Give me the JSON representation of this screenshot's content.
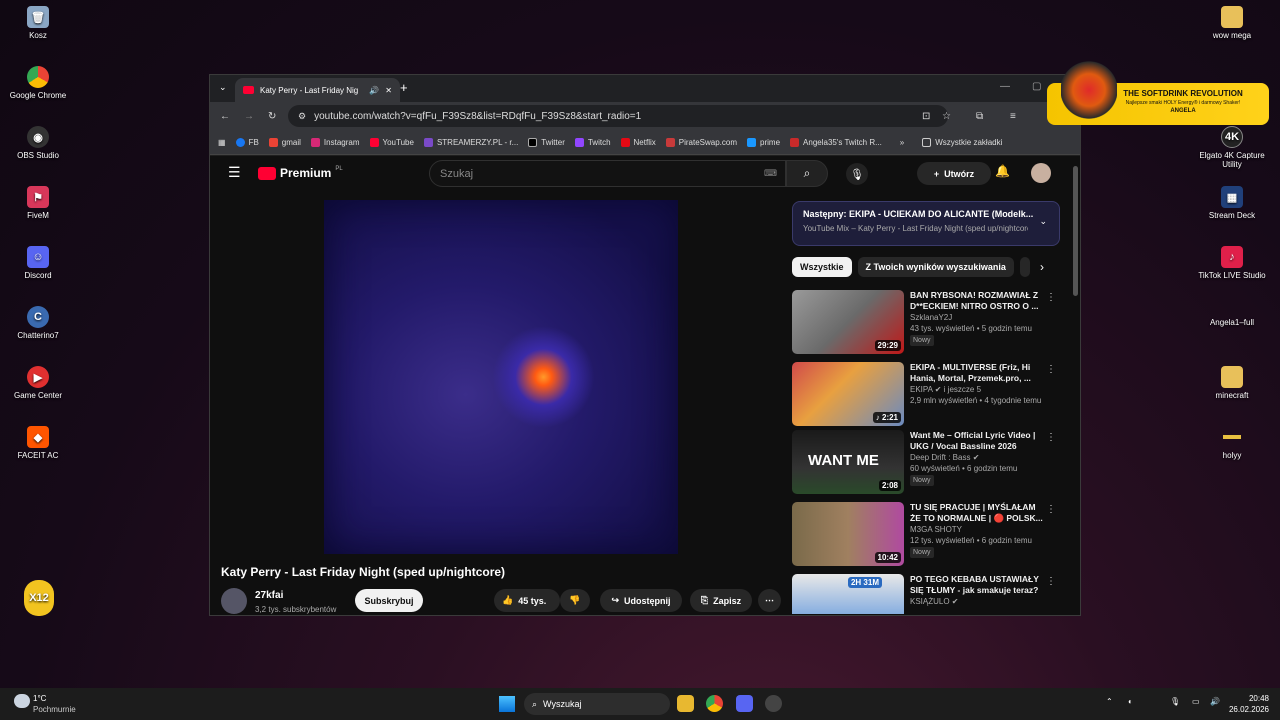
{
  "desktop": {
    "left": [
      "Kosz",
      "Google Chrome",
      "OBS Studio",
      "FiveM",
      "Discord",
      "Chatterino7",
      "Game Center",
      "FACEIT AC"
    ],
    "right": [
      "wow mega",
      "",
      "Elgato 4K Capture Utility",
      "Stream Deck",
      "TikTok LIVE Studio",
      "Angela1–full",
      "minecraft",
      "holyy"
    ]
  },
  "tab": {
    "title": "Katy Perry - Last Friday Nig"
  },
  "address": "youtube.com/watch?v=qfFu_F39Sz8&list=RDqfFu_F39Sz8&start_radio=1",
  "bookmarks": [
    "FB",
    "gmail",
    "Instagram",
    "YouTube",
    "STREAMERZY.PL - r...",
    "Twitter",
    "Twitch",
    "Netflix",
    "PirateSwap.com",
    "prime",
    "Angela35's Twitch R..."
  ],
  "all_bookmarks": "Wszystkie zakładki",
  "yt": {
    "logo": "Premium",
    "region": "PL",
    "search_placeholder": "Szukaj",
    "create": "Utwórz"
  },
  "video": {
    "title": "Katy Perry - Last Friday Night (sped up/nightcore)",
    "channel": "27kfai",
    "subs": "3,2 tys. subskrybentów",
    "subscribe": "Subskrybuj",
    "likes": "45 tys.",
    "share": "Udostępnij",
    "save": "Zapisz"
  },
  "next": {
    "label": "Następny:",
    "title": "EKIPA - UCIEKAM DO ALICANTE (Modelk...",
    "sub": "YouTube Mix – Katy Perry - Last Friday Night (sped up/nightcore)"
  },
  "chips": [
    "Wszystkie",
    "Z Twoich wyników wyszukiwania"
  ],
  "recs": [
    {
      "t1": "BAN RYBSONA! ROZMAWIAŁ Z",
      "t2": "D**ECKIEM! NITRO OSTRO O ...",
      "ch": "SzklanaY2J",
      "meta": "43 tys. wyświetleń • 5 godzin temu",
      "badge": "Nowy",
      "dur": "29:29",
      "c1": "#9a9a9a",
      "c2": "#c01818"
    },
    {
      "t1": "EKIPA - MULTIVERSE (Friz, Hi",
      "t2": "Hania, Mortal, Przemek.pro, ...",
      "ch": "EKIPA ✔ i jeszcze 5",
      "meta": "2,9 mln wyświetleń • 4 tygodnie temu",
      "badge": "",
      "dur": "♪ 2:21",
      "c1": "#d04a4a",
      "c2": "#6a8ac0"
    },
    {
      "t1": "Want Me – Official Lyric Video |",
      "t2": "UKG / Vocal Bassline 2026",
      "ch": "Deep Drift : Bass ✔",
      "meta": "60 wyświetleń • 6 godzin temu",
      "badge": "Nowy",
      "dur": "2:08",
      "c1": "#1a1a1a",
      "c2": "#2a4a2a"
    },
    {
      "t1": "TU SIĘ PRACUJE | MYŚLAŁAM",
      "t2": "ŻE TO NORMALNE | 🔴 POLSK...",
      "ch": "M3GA SHOTY",
      "meta": "12 tys. wyświetleń • 6 godzin temu",
      "badge": "Nowy",
      "dur": "10:42",
      "c1": "#7a6a4a",
      "c2": "#b04aa0"
    },
    {
      "t1": "PO TEGO KEBABA USTAWIAŁY",
      "t2": "SIĘ TŁUMY - jak smakuje teraz?",
      "ch": "KSIĄŻULO ✔",
      "meta": "",
      "badge": "",
      "dur": "2H 31M",
      "c1": "#e8e8e8",
      "c2": "#2a6ac0"
    }
  ],
  "ad": {
    "title": "THE SOFTDRINK REVOLUTION",
    "line": "Najlepsze smaki HOLY Energy® i darmowy Shaker!",
    "name": "ANGELA"
  },
  "taskbar": {
    "temp": "1°C",
    "weather": "Pochmurnie",
    "search": "Wyszukaj",
    "time": "20:48",
    "date": "26.02.2026"
  }
}
